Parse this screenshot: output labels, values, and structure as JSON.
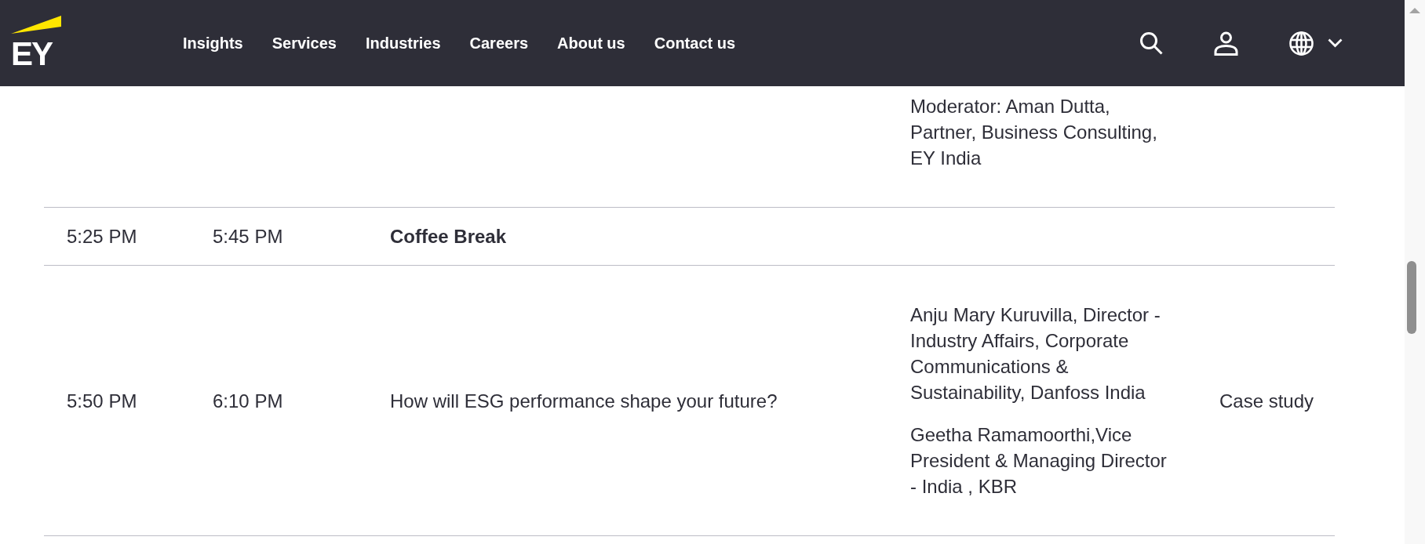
{
  "header": {
    "logo": {
      "text": "EY"
    },
    "nav_links": [
      "Insights",
      "Services",
      "Industries",
      "Careers",
      "About us",
      "Contact us"
    ]
  },
  "table": {
    "rows": [
      {
        "kind": "session",
        "column_4": [
          "Moderator: Aman Dutta, Partner, Business Consulting, EY India"
        ]
      },
      {
        "kind": "break",
        "column_1": "5:25 PM",
        "column_2": "5:45 PM",
        "column_3": "Coffee Break"
      },
      {
        "kind": "session",
        "column_1": "5:50 PM",
        "column_2": "6:10 PM",
        "column_3": "How will ESG performance shape your future?",
        "column_4": [
          "Anju Mary Kuruvilla, Director - Industry Affairs, Corporate Communications & Sustainability, Danfoss India",
          "Geetha Ramamoorthi,Vice President & Managing Director - India , KBR"
        ],
        "column_5": "Case study"
      }
    ]
  }
}
